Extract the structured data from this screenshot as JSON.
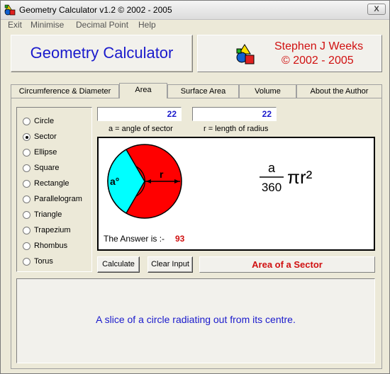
{
  "window": {
    "title": "Geometry Calculator v1.2 ©  2002 - 2005",
    "close_label": "X"
  },
  "menu": {
    "items": [
      "Exit",
      "Minimise",
      "Decimal Point",
      "Help"
    ]
  },
  "header": {
    "app_name": "Geometry Calculator",
    "author_name": "Stephen J Weeks",
    "author_years": "© 2002 - 2005"
  },
  "tabs": [
    {
      "label": "Circumference & Diameter",
      "active": false
    },
    {
      "label": "Area",
      "active": true
    },
    {
      "label": "Surface Area",
      "active": false
    },
    {
      "label": "Volume",
      "active": false
    },
    {
      "label": "About the Author",
      "active": false
    }
  ],
  "shapes": [
    {
      "label": "Circle",
      "selected": false
    },
    {
      "label": "Sector",
      "selected": true
    },
    {
      "label": "Ellipse",
      "selected": false
    },
    {
      "label": "Square",
      "selected": false
    },
    {
      "label": "Rectangle",
      "selected": false
    },
    {
      "label": "Parallelogram",
      "selected": false
    },
    {
      "label": "Triangle",
      "selected": false
    },
    {
      "label": "Trapezium",
      "selected": false
    },
    {
      "label": "Rhombus",
      "selected": false
    },
    {
      "label": "Torus",
      "selected": false
    }
  ],
  "inputs": {
    "angle": {
      "value": "22",
      "caption": "a = angle of sector"
    },
    "radius": {
      "value": "22",
      "caption": "r = length of radius"
    }
  },
  "diagram": {
    "angle_symbol": "a°",
    "radius_symbol": "r",
    "circle_color": "#ff0000",
    "sector_color": "#00ffff"
  },
  "formula": {
    "numerator": "a",
    "denominator": "360",
    "tail": "πr²"
  },
  "answer": {
    "label": "The Answer is :-",
    "value": "93"
  },
  "buttons": {
    "calculate": "Calculate",
    "clear_input": "Clear Input"
  },
  "result_title": "Area of a Sector",
  "description": "A slice of a circle radiating out from its centre.",
  "colors": {
    "accent_blue": "#1a1acc",
    "accent_red": "#d01010",
    "face": "#ece9d8"
  }
}
